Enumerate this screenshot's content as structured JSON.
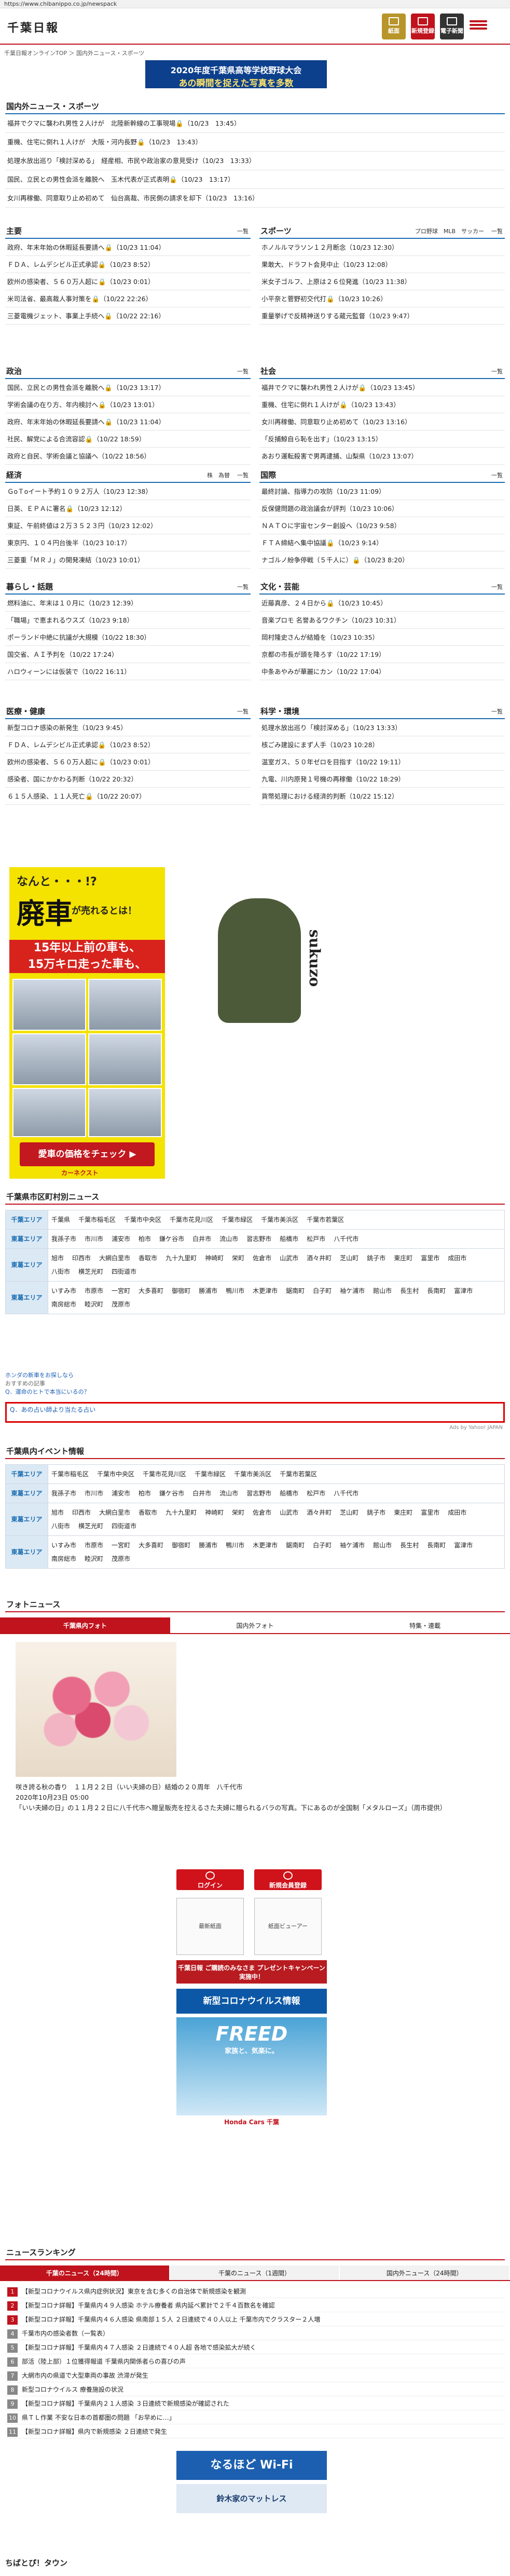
{
  "url": "https://www.chibanippo.co.jp/newspack",
  "logo": "千葉日報",
  "header_buttons": {
    "paper": "紙面",
    "signup": "新規登録",
    "e_paper": "電子新聞"
  },
  "breadcrumb": "千葉日報オンラインTOP ＞ 国内外ニュース・スポーツ",
  "banner": {
    "line1": "2020年度千葉県高等学校野球大会",
    "line2": "あの瞬間を捉えた写真を多数"
  },
  "top_section": {
    "title": "国内外ニュース・スポーツ",
    "items": [
      "福井でクマに襲われ男性２人けが　北陸新幹線の工事現場🔒（10/23　13:45）",
      "重機、住宅に倒れ１人けが　大阪・河内長野🔒（10/23　13:43）",
      "処理水放出巡り「検討深める」　経産相、市民や政治家の意見受け（10/23　13:33）",
      "国民、立民との男性会派を離脱へ　玉木代表が正式表明🔒（10/23　13:17）",
      "女川再稼働、同意取り止め初めて　仙台高裁、市民側の請求を却下（10/23　13:16）"
    ]
  },
  "sections": [
    {
      "title": "主要",
      "tabs": "",
      "items": [
        "政府、年末年始の休暇延長要請へ🔒（10/23 11:04）",
        "ＦＤＡ、レムデシビル正式承認🔒（10/23 8:52）",
        "欧州の感染者、５６０万人超に🔒（10/23 0:01）",
        "米司法省、最高裁人事対策を🔒（10/22 22:26）",
        "三菱電機ジェット、事業上手続へ🔒（10/22 22:16）"
      ]
    },
    {
      "title": "スポーツ",
      "tabs": "プロ野球　MLB　サッカー",
      "items": [
        "ホノルルマラソン１２月断念（10/23 12:30）",
        "果敢大、ドラフト会見中止（10/23 12:08）",
        "米女子ゴルフ、上原は２６位発進（10/23 11:38）",
        "小平奈と菅野初交代打🔒（10/23 10:26）",
        "重量挙げで反精神送りする蔵元監督（10/23 9:47）"
      ]
    },
    {
      "title": "政治",
      "tabs": "",
      "items": [
        "国民、立民との男性会派を離脱へ🔒（10/23 13:17）",
        "学術会議の在り方、年内検討へ🔒（10/23 13:01）",
        "政府、年末年始の休暇延長要請へ🔒（10/23 11:04）",
        "社民、解党による合流容認🔒（10/22 18:59）",
        "政府と自民、学術会議と協議へ（10/22 18:56）"
      ]
    },
    {
      "title": "社会",
      "tabs": "",
      "items": [
        "福井でクマに襲われ男性２人けが🔒（10/23 13:45）",
        "重機、住宅に倒れ１人けが🔒（10/23 13:43）",
        "女川再稼働、同意取り止め初めて（10/23 13:16）",
        "「反捕鯨自ら恥を出す」（10/23 13:15）",
        "あおり運転殺害で男再逮捕、山梨県（10/23 13:07）"
      ]
    },
    {
      "title": "経済",
      "tabs": "株　為替",
      "items": [
        "ＧoＴoイート予約１０９２万人（10/23 12:38）",
        "日英、ＥＰＡに署名🔒（10/23 12:12）",
        "東証、午前終値は２万３５２３円（10/23 12:02）",
        "東京円、１０４円台後半（10/23 10:17）",
        "三菱重「ＭＲＪ」の開発凍結（10/23 10:01）"
      ]
    },
    {
      "title": "国際",
      "tabs": "",
      "items": [
        "最終討論、指導力の攻防（10/23 11:09）",
        "反保健問題の政治議会が評判（10/23 10:06）",
        "ＮＡＴＯに宇宙センター創設へ（10/23 9:58）",
        "ＦＴＡ締結へ集中協議🔒（10/23 9:14）",
        "ナゴルノ紛争停戦（５千人に）🔒（10/23 8:20）"
      ]
    },
    {
      "title": "暮らし・話題",
      "tabs": "",
      "items": [
        "燃料油に、年末は１０月に（10/23 12:39）",
        "「職場」で恵まれるウスズ（10/23 9:18）",
        "ポーランド中絶に抗議が大規模（10/22 18:30）",
        "国交省、ＡＩ予判を（10/22 17:24）",
        "ハロウィーンには仮装で（10/22 16:11）"
      ]
    },
    {
      "title": "文化・芸能",
      "tabs": "",
      "items": [
        "近藤真彦、２４日から🔒（10/23 10:45）",
        "音楽プロモ 名誉あるワクチン（10/23 10:31）",
        "岡村隆史さんが結婚を（10/23 10:35）",
        "京都の市長が頭を降ろす（10/22 17:19）",
        "中条あやみが華麗にカン（10/22 17:04）"
      ]
    },
    {
      "title": "医療・健康",
      "tabs": "",
      "items": [
        "新型コロナ感染の新発生（10/23 9:45）",
        "ＦＤＡ、レムデシビル正式承認🔒（10/23 8:52）",
        "欧州の感染者、５６０万人超に🔒（10/23 0:01）",
        "感染者、国にかかわる判断（10/22 20:32）",
        "６１５人感染、１１人死亡🔒（10/22 20:07）"
      ]
    },
    {
      "title": "科学・環境",
      "tabs": "",
      "items": [
        "処理水放出巡り「検討深める」（10/23 13:33）",
        "核ごみ建設にまず人手（10/23 10:28）",
        "温室ガス、５０年ゼロを目指す（10/22 19:11）",
        "九電、川内原発１号機の再稼働（10/22 18:29）",
        "貨幣処理における経済的判断（10/22 15:12）"
      ]
    }
  ],
  "car_ad": {
    "t1": "なんと・・・!?",
    "t2": "廃車",
    "t3": "が売れるとは！",
    "band1": "15年以上前の車も、",
    "band2": "15万キロ走った車も、",
    "cta": "愛車の価格をチェック ▶",
    "brand": "カーネクスト"
  },
  "hood_ad": {
    "brand": "sukuzo"
  },
  "city_section": {
    "title": "千葉県市区町村別ニュース",
    "rows": [
      {
        "label": "千葉エリア",
        "items": [
          "千葉県",
          "千葉市稲毛区",
          "千葉市中央区",
          "千葉市花見川区",
          "千葉市緑区",
          "千葉市美浜区",
          "千葉市若葉区"
        ]
      },
      {
        "label": "東葛エリア",
        "items": [
          "我孫子市",
          "市川市",
          "浦安市",
          "柏市",
          "鎌ケ谷市",
          "白井市",
          "流山市",
          "習志野市",
          "船橋市",
          "松戸市",
          "八千代市"
        ]
      },
      {
        "label": "東葛エリア",
        "items": [
          "旭市",
          "印西市",
          "大網白里市",
          "香取市",
          "九十九里町",
          "神崎町",
          "栄町",
          "佐倉市",
          "山武市",
          "酒々井町",
          "芝山町",
          "銚子市",
          "東庄町",
          "富里市",
          "成田市",
          "八街市",
          "横芝光町",
          "四街道市"
        ]
      },
      {
        "label": "東葛エリア",
        "items": [
          "いすみ市",
          "市原市",
          "一宮町",
          "大多喜町",
          "御宿町",
          "勝浦市",
          "鴨川市",
          "木更津市",
          "鋸南町",
          "白子町",
          "袖ケ浦市",
          "館山市",
          "長生村",
          "長南町",
          "富津市",
          "南房総市",
          "睦沢町",
          "茂原市"
        ]
      }
    ]
  },
  "sponsor": {
    "label": "ホンダの新車をお探しなら",
    "sub": "おすすめの記事",
    "item1": "Q．運命のヒトで本当にいるの？",
    "item2": "Q．あの占い師より当たる占い",
    "note": "Ads by Yahoo! JAPAN"
  },
  "event_section": {
    "title": "千葉県内イベント情報",
    "rows": [
      {
        "label": "千葉エリア",
        "items": [
          "千葉市稲毛区",
          "千葉市中央区",
          "千葉市花見川区",
          "千葉市緑区",
          "千葉市美浜区",
          "千葉市若葉区"
        ]
      },
      {
        "label": "東葛エリア",
        "items": [
          "我孫子市",
          "市川市",
          "浦安市",
          "柏市",
          "鎌ケ谷市",
          "白井市",
          "流山市",
          "習志野市",
          "船橋市",
          "松戸市",
          "八千代市"
        ]
      },
      {
        "label": "東葛エリア",
        "items": [
          "旭市",
          "印西市",
          "大網白里市",
          "香取市",
          "九十九里町",
          "神崎町",
          "栄町",
          "佐倉市",
          "山武市",
          "酒々井町",
          "芝山町",
          "銚子市",
          "東庄町",
          "富里市",
          "成田市",
          "八街市",
          "横芝光町",
          "四街道市"
        ]
      },
      {
        "label": "東葛エリア",
        "items": [
          "いすみ市",
          "市原市",
          "一宮町",
          "大多喜町",
          "御宿町",
          "勝浦市",
          "鴨川市",
          "木更津市",
          "鋸南町",
          "白子町",
          "袖ケ浦市",
          "館山市",
          "長生村",
          "長南町",
          "富津市",
          "南房総市",
          "睦沢町",
          "茂原市"
        ]
      }
    ]
  },
  "photo": {
    "title": "フォトニュース",
    "tabs": [
      "千葉県内フォト",
      "国内外フォト",
      "特集・連載"
    ],
    "cap1": "咲き誇る秋の香り　１１月２２日（いい夫婦の日）結婚の２０周年　八千代市",
    "cap2": "2020年10月23日 05:00",
    "cap3": "「いい夫婦の日」の１１月２２日に八千代市へ贈呈販売を控えるさた夫婦に贈られるバラの写真。下にあるのが全国制「メタルローズ」（周市提供）"
  },
  "side": {
    "login": "ログイン",
    "signup": "新規会員登録",
    "paper_title": "最新紙面",
    "viewer": "紙面ビューアー",
    "present": "千葉日報 ご購読のみなさま プレゼントキャンペーン実施中！",
    "corona": "新型コロナウイルス情報",
    "freed": "FREED",
    "freed_sub": "家族と、気楽に。",
    "honda": "Honda Cars 千葉"
  },
  "ranking": {
    "title": "ニュースランキング",
    "tabs": [
      "千葉のニュース（24時間）",
      "千葉のニュース（1週間）",
      "国内外ニュース（24時間）"
    ],
    "items": [
      "【新型コロナウイルス県内症例状況】東京を含む多くの自治体で新規感染を観測",
      "【新型コロナ詳報】千葉県内４９人感染 ホテル療養者 県内延べ累計で２千４百数名を確認",
      "【新型コロナ詳報】千葉県内４６人感染 県南部１５人 ２日連続で４０人以上 千葉市内でクラスター２人増",
      "千葉市内の感染者数（一覧表）",
      "【新型コロナ詳報】千葉県内４７人感染 ２日連続で４０人超 各地で感染拡大が続く",
      "部活（陸上部）１位獲得報道 千葉県内関係者らの喜びの声",
      "大網市内の県道で大型車両の事故 渋滞が発生",
      "新型コロナウイルス 療養施設の状況",
      "【新型コロナ詳報】千葉県内２１人感染 ３日連続で新規感染が確認された",
      "県ＴＬ作業 不安な日本の首都圏の問題 「お早めに…」",
      "【新型コロナ詳報】県内で新規感染 ２日連続で発生"
    ]
  },
  "bottom_ads": {
    "wifi": "なるほど Wi-Fi",
    "mattress": "鈴木家のマットレス"
  },
  "footer_title": "ちばとぴ！タウン"
}
